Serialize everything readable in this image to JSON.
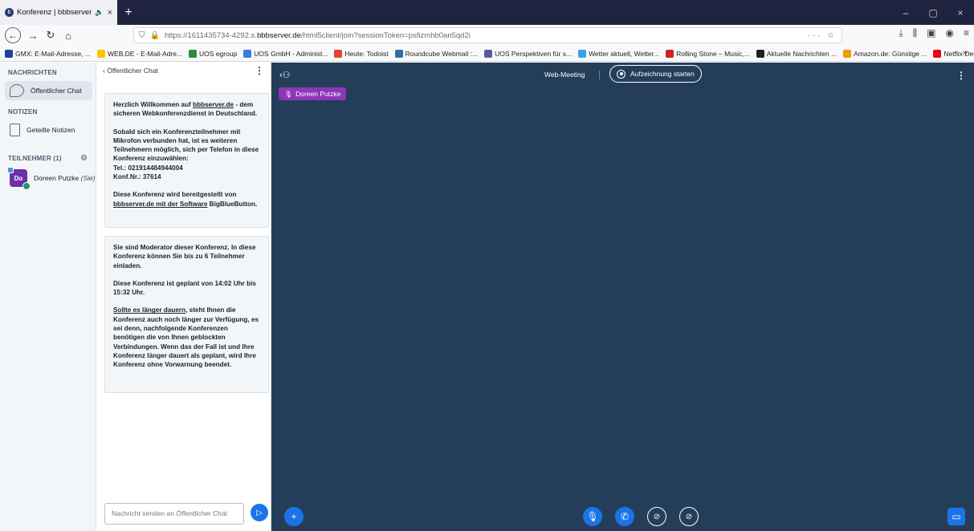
{
  "browser": {
    "tab_title": "Konferenz | bbbserver.de -",
    "tab_audio": "🔈",
    "tab_close": "×",
    "new_tab": "+",
    "win_minimize": "–",
    "win_maximize": "▢",
    "win_close": "×",
    "url_prefix": "https://1611435734-4292.s.",
    "url_domain": "bbbserver.de",
    "url_suffix": "/html5client/join?sessionToken=psfizmhb0an5qd2i",
    "bookmarks": [
      {
        "label": "GMX: E-Mail-Adresse, ...",
        "color": "#1c449b"
      },
      {
        "label": "WEB.DE - E-Mail-Adre...",
        "color": "#f6c400"
      },
      {
        "label": "UOS egroup",
        "color": "#2a8c3c"
      },
      {
        "label": "UOS GmbH - Administ...",
        "color": "#3b7dd8"
      },
      {
        "label": "Heute: Todoist",
        "color": "#e44332"
      },
      {
        "label": "Roundcube Webmail :...",
        "color": "#2f6fa7"
      },
      {
        "label": "UOS Perspektiven für s...",
        "color": "#5a5a9a"
      },
      {
        "label": "Wetter aktuell, Wetter...",
        "color": "#3aa0e8"
      },
      {
        "label": "Rolling Stone – Music,...",
        "color": "#d02020"
      },
      {
        "label": "Aktuelle Nachrichten ...",
        "color": "#222222"
      },
      {
        "label": "Amazon.de: Günstige ...",
        "color": "#f29b05"
      },
      {
        "label": "Netflix Deutschland – ...",
        "color": "#e50914"
      }
    ],
    "bookmarks_more": "»"
  },
  "sidebar": {
    "messages_title": "NACHRICHTEN",
    "public_chat": "Öffentlicher Chat",
    "notes_title": "NOTIZEN",
    "shared_notes": "Geteilte Notizen",
    "participants_title": "TEILNEHMER (1)",
    "user": {
      "initials": "Do",
      "name": "Doreen Putzke",
      "you": "(Sie)"
    }
  },
  "chat": {
    "header": "Öffentlicher Chat",
    "back": "‹",
    "menu": "⋮",
    "msg1": {
      "p1_a": "Herzlich Willkommen auf ",
      "p1_link": "bbbserver.de",
      "p1_b": " - dem sicheren Webkonferenzdienst in Deutschland.",
      "p2": "Sobald sich ein Konferenzteilnehmer mit Mikrofon verbunden hat, ist es weiteren Teilnehmern möglich, sich per Telefon in diese Konferenz einzuwählen:",
      "p2_tel": "Tel.: 021914484944004",
      "p2_conf": "Konf.Nr.: 37614",
      "p3_a": "Diese Konferenz wird bereitgestellt von ",
      "p3_link": "bbbserver.de mit der Software",
      "p3_b": " BigBlueButton."
    },
    "msg2": {
      "p1": "Sie sind Moderator dieser Konferenz. In diese Konferenz können Sie bis zu 6 Teilnehmer einladen.",
      "p2": "Diese Konferenz ist geplant von 14:02 Uhr bis 15:32 Uhr.",
      "p3_link": "Sollte es länger dauern",
      "p3": ", steht Ihnen die Konferenz auch noch länger zur Verfügung, es sei denn, nachfolgende Konferenzen benötigen die von Ihnen geblockten Verbindungen. Wenn das der Fall ist und Ihre Konferenz länger dauert als geplant, wird Ihre Konferenz ohne Vorwarnung beendet."
    },
    "input_placeholder": "Nachricht senden an Öffentlicher Chat"
  },
  "stage": {
    "meeting_title": "Web-Meeting",
    "record_label": "Aufzeichnung starten",
    "talker": "Doreen Putzke",
    "menu": "⋮"
  },
  "colors": {
    "stage_bg": "#243e5a",
    "accent_blue": "#1b73e8",
    "avatar_purple": "#6d2fab",
    "talker_purple": "#8e35b8"
  }
}
